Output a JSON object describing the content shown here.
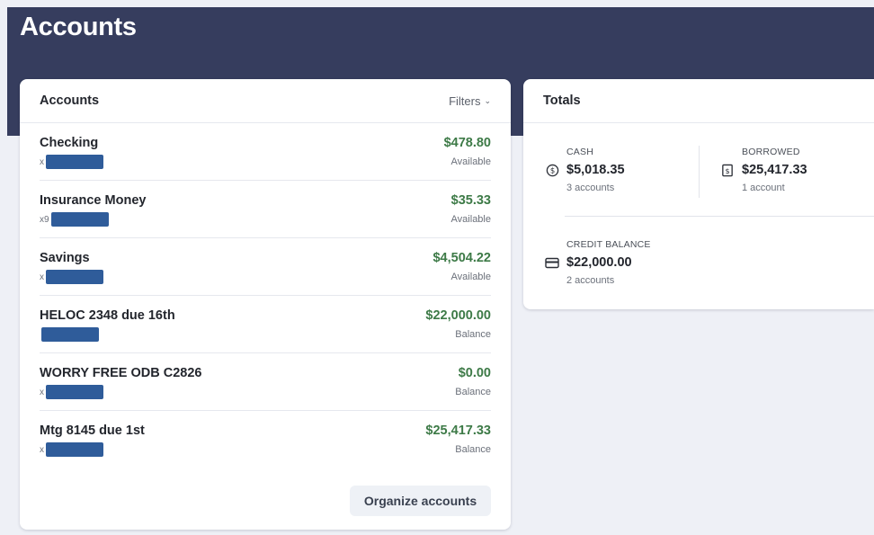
{
  "page": {
    "title": "Accounts"
  },
  "accounts_card": {
    "title": "Accounts",
    "filters_label": "Filters",
    "organize_label": "Organize accounts",
    "rows": [
      {
        "name": "Checking",
        "mask_prefix": "x",
        "amount": "$478.80",
        "sub": "Available"
      },
      {
        "name": "Insurance Money",
        "mask_prefix": "x9",
        "amount": "$35.33",
        "sub": "Available"
      },
      {
        "name": "Savings",
        "mask_prefix": "x",
        "amount": "$4,504.22",
        "sub": "Available"
      },
      {
        "name": "HELOC 2348 due 16th",
        "mask_prefix": "",
        "amount": "$22,000.00",
        "sub": "Balance"
      },
      {
        "name": "WORRY FREE ODB C2826",
        "mask_prefix": "x",
        "amount": "$0.00",
        "sub": "Balance"
      },
      {
        "name": "Mtg 8145 due 1st",
        "mask_prefix": "x",
        "amount": "$25,417.33",
        "sub": "Balance"
      }
    ]
  },
  "totals_card": {
    "title": "Totals",
    "cash": {
      "label": "CASH",
      "value": "$5,018.35",
      "sub": "3 accounts",
      "icon": "dollar-circle-icon"
    },
    "borrowed": {
      "label": "BORROWED",
      "value": "$25,417.33",
      "sub": "1 account",
      "icon": "bill-icon"
    },
    "credit": {
      "label": "CREDIT BALANCE",
      "value": "$22,000.00",
      "sub": "2 accounts",
      "icon": "credit-card-icon"
    }
  },
  "colors": {
    "header": "#363d5e",
    "amount_green": "#3d7a47",
    "mask_blue": "#2f5c9a",
    "background": "#eef0f6"
  }
}
